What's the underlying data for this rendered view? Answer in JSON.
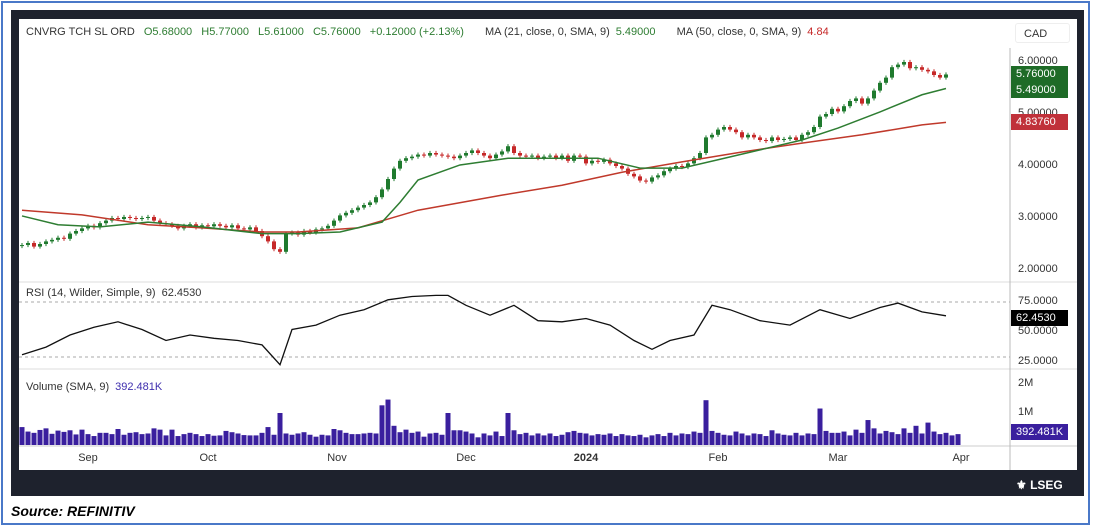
{
  "header": {
    "symbol": "CNVRG TCH SL ORD",
    "open": "O5.68000",
    "high": "H5.77000",
    "low": "L5.61000",
    "close": "C5.76000",
    "change": "+0.12000 (+2.13%)",
    "ma21_label": "MA (21, close, 0, SMA, 9)",
    "ma21_value": "5.49000",
    "ma50_label": "MA (50, close, 0, SMA, 9)",
    "ma50_value": "4.84"
  },
  "currency": "CAD",
  "price_axis": {
    "ticks": [
      "6.00000",
      "5.00000",
      "4.00000",
      "3.00000",
      "2.00000"
    ],
    "last_close": "5.76000",
    "ma21": "5.49000",
    "ma50": "4.83760"
  },
  "rsi": {
    "label": "RSI (14, Wilder, Simple, 9)",
    "value": "62.4530",
    "ticks": [
      "75.0000",
      "50.0000",
      "25.0000"
    ]
  },
  "volume": {
    "label": "Volume (SMA, 9)",
    "value": "392.481K",
    "ticks": [
      "2M",
      "1M"
    ]
  },
  "x_axis": [
    {
      "label": "Sep",
      "bar": 11
    },
    {
      "label": "Oct",
      "bar": 31
    },
    {
      "label": "Nov",
      "bar": 52.5
    },
    {
      "label": "Dec",
      "bar": 74
    },
    {
      "label": "2024",
      "bar": 94
    },
    {
      "label": "Feb",
      "bar": 116
    },
    {
      "label": "Mar",
      "bar": 136
    },
    {
      "label": "Apr",
      "bar": 156.5
    }
  ],
  "brand": "LSEG",
  "source": "Source: REFINITIV",
  "colors": {
    "up": "#1f7a2e",
    "down": "#c62828",
    "ma21": "#2e7d32",
    "ma50": "#c0392b",
    "volume": "#3a1f9e",
    "rsi": "#111111"
  },
  "chart_data": {
    "type": "candlestick",
    "title": "CNVRG TCH SL ORD",
    "ylim": [
      2,
      6
    ],
    "closes": [
      2.48,
      2.52,
      2.45,
      2.5,
      2.55,
      2.58,
      2.62,
      2.6,
      2.7,
      2.75,
      2.8,
      2.85,
      2.82,
      2.9,
      2.95,
      3.0,
      2.98,
      3.02,
      3.0,
      2.98,
      3.0,
      3.02,
      2.95,
      2.9,
      2.88,
      2.85,
      2.8,
      2.85,
      2.88,
      2.82,
      2.86,
      2.84,
      2.88,
      2.85,
      2.82,
      2.86,
      2.8,
      2.78,
      2.82,
      2.75,
      2.65,
      2.55,
      2.4,
      2.35,
      2.7,
      2.72,
      2.68,
      2.75,
      2.72,
      2.78,
      2.8,
      2.85,
      2.95,
      3.05,
      3.1,
      3.15,
      3.2,
      3.25,
      3.3,
      3.4,
      3.55,
      3.75,
      3.95,
      4.1,
      4.15,
      4.18,
      4.22,
      4.2,
      4.25,
      4.22,
      4.2,
      4.18,
      4.15,
      4.2,
      4.25,
      4.3,
      4.25,
      4.2,
      4.15,
      4.22,
      4.28,
      4.38,
      4.25,
      4.2,
      4.18,
      4.2,
      4.15,
      4.18,
      4.2,
      4.15,
      4.2,
      4.1,
      4.2,
      4.18,
      4.05,
      4.1,
      4.08,
      4.12,
      4.05,
      4.0,
      3.95,
      3.85,
      3.8,
      3.72,
      3.7,
      3.78,
      3.82,
      3.9,
      3.95,
      4.0,
      3.98,
      4.05,
      4.15,
      4.25,
      4.55,
      4.6,
      4.7,
      4.75,
      4.7,
      4.65,
      4.55,
      4.6,
      4.55,
      4.5,
      4.48,
      4.55,
      4.5,
      4.52,
      4.55,
      4.5,
      4.6,
      4.65,
      4.75,
      4.95,
      5.0,
      5.1,
      5.05,
      5.15,
      5.25,
      5.3,
      5.2,
      5.3,
      5.45,
      5.6,
      5.7,
      5.9,
      5.95,
      6.0,
      5.88,
      5.9,
      5.85,
      5.82,
      5.75,
      5.7,
      5.76
    ],
    "ma21": [
      [
        0,
        3.04
      ],
      [
        6,
        2.87
      ],
      [
        13,
        2.83
      ],
      [
        21,
        2.92
      ],
      [
        30,
        2.83
      ],
      [
        40,
        2.7
      ],
      [
        46,
        2.7
      ],
      [
        53,
        2.73
      ],
      [
        60,
        2.92
      ],
      [
        63,
        3.3
      ],
      [
        66,
        3.73
      ],
      [
        73,
        4.02
      ],
      [
        81,
        4.15
      ],
      [
        90,
        4.15
      ],
      [
        96,
        4.15
      ],
      [
        103,
        3.96
      ],
      [
        110,
        3.96
      ],
      [
        116,
        4.12
      ],
      [
        123,
        4.31
      ],
      [
        130,
        4.5
      ],
      [
        136,
        4.73
      ],
      [
        143,
        5.04
      ],
      [
        150,
        5.37
      ],
      [
        154,
        5.49
      ]
    ],
    "ma50": [
      [
        0,
        3.15
      ],
      [
        10,
        3.06
      ],
      [
        21,
        2.87
      ],
      [
        30,
        2.81
      ],
      [
        40,
        2.73
      ],
      [
        46,
        2.73
      ],
      [
        56,
        2.81
      ],
      [
        66,
        3.15
      ],
      [
        80,
        3.44
      ],
      [
        90,
        3.63
      ],
      [
        100,
        3.88
      ],
      [
        110,
        4.08
      ],
      [
        120,
        4.27
      ],
      [
        130,
        4.44
      ],
      [
        140,
        4.6
      ],
      [
        150,
        4.79
      ],
      [
        154,
        4.84
      ]
    ],
    "rsi": [
      [
        0,
        27
      ],
      [
        4,
        34
      ],
      [
        8,
        45
      ],
      [
        12,
        52
      ],
      [
        16,
        57
      ],
      [
        20,
        50
      ],
      [
        24,
        40
      ],
      [
        28,
        45
      ],
      [
        32,
        42
      ],
      [
        36,
        40
      ],
      [
        40,
        36
      ],
      [
        43,
        18
      ],
      [
        45,
        50
      ],
      [
        49,
        54
      ],
      [
        53,
        63
      ],
      [
        57,
        68
      ],
      [
        61,
        77
      ],
      [
        65,
        80
      ],
      [
        69,
        81
      ],
      [
        71,
        81
      ],
      [
        74,
        72
      ],
      [
        78,
        63
      ],
      [
        82,
        72
      ],
      [
        86,
        58
      ],
      [
        90,
        57
      ],
      [
        94,
        60
      ],
      [
        98,
        54
      ],
      [
        102,
        40
      ],
      [
        105,
        32
      ],
      [
        108,
        40
      ],
      [
        112,
        45
      ],
      [
        115,
        72
      ],
      [
        118,
        68
      ],
      [
        123,
        58
      ],
      [
        128,
        54
      ],
      [
        133,
        68
      ],
      [
        138,
        60
      ],
      [
        143,
        70
      ],
      [
        146,
        74
      ],
      [
        150,
        66
      ],
      [
        154,
        62.45
      ]
    ],
    "rsi_ylim": [
      0,
      100
    ],
    "volume_k": [
      560,
      420,
      380,
      470,
      520,
      350,
      450,
      410,
      460,
      330,
      480,
      340,
      280,
      380,
      380,
      340,
      500,
      320,
      380,
      400,
      340,
      360,
      520,
      480,
      300,
      480,
      280,
      340,
      380,
      340,
      280,
      340,
      290,
      300,
      440,
      400,
      360,
      310,
      300,
      300,
      380,
      560,
      320,
      1000,
      360,
      320,
      360,
      400,
      320,
      260,
      320,
      300,
      500,
      460,
      380,
      340,
      340,
      360,
      380,
      360,
      1240,
      1420,
      600,
      400,
      480,
      380,
      420,
      260,
      360,
      380,
      320,
      1000,
      460,
      460,
      420,
      360,
      240,
      360,
      300,
      420,
      280,
      1000,
      460,
      340,
      380,
      300,
      360,
      300,
      360,
      280,
      320,
      400,
      440,
      380,
      360,
      300,
      340,
      320,
      360,
      280,
      340,
      300,
      280,
      320,
      240,
      300,
      340,
      280,
      380,
      300,
      360,
      340,
      420,
      380,
      1400,
      440,
      380,
      320,
      300,
      420,
      360,
      300,
      360,
      340,
      280,
      460,
      360,
      320,
      300,
      380,
      300,
      360,
      340,
      1140,
      440,
      380,
      380,
      420,
      300,
      480,
      380,
      780,
      520,
      360,
      440,
      400,
      340,
      520,
      380,
      600,
      360,
      700,
      420,
      340,
      380,
      300,
      340
    ]
  }
}
